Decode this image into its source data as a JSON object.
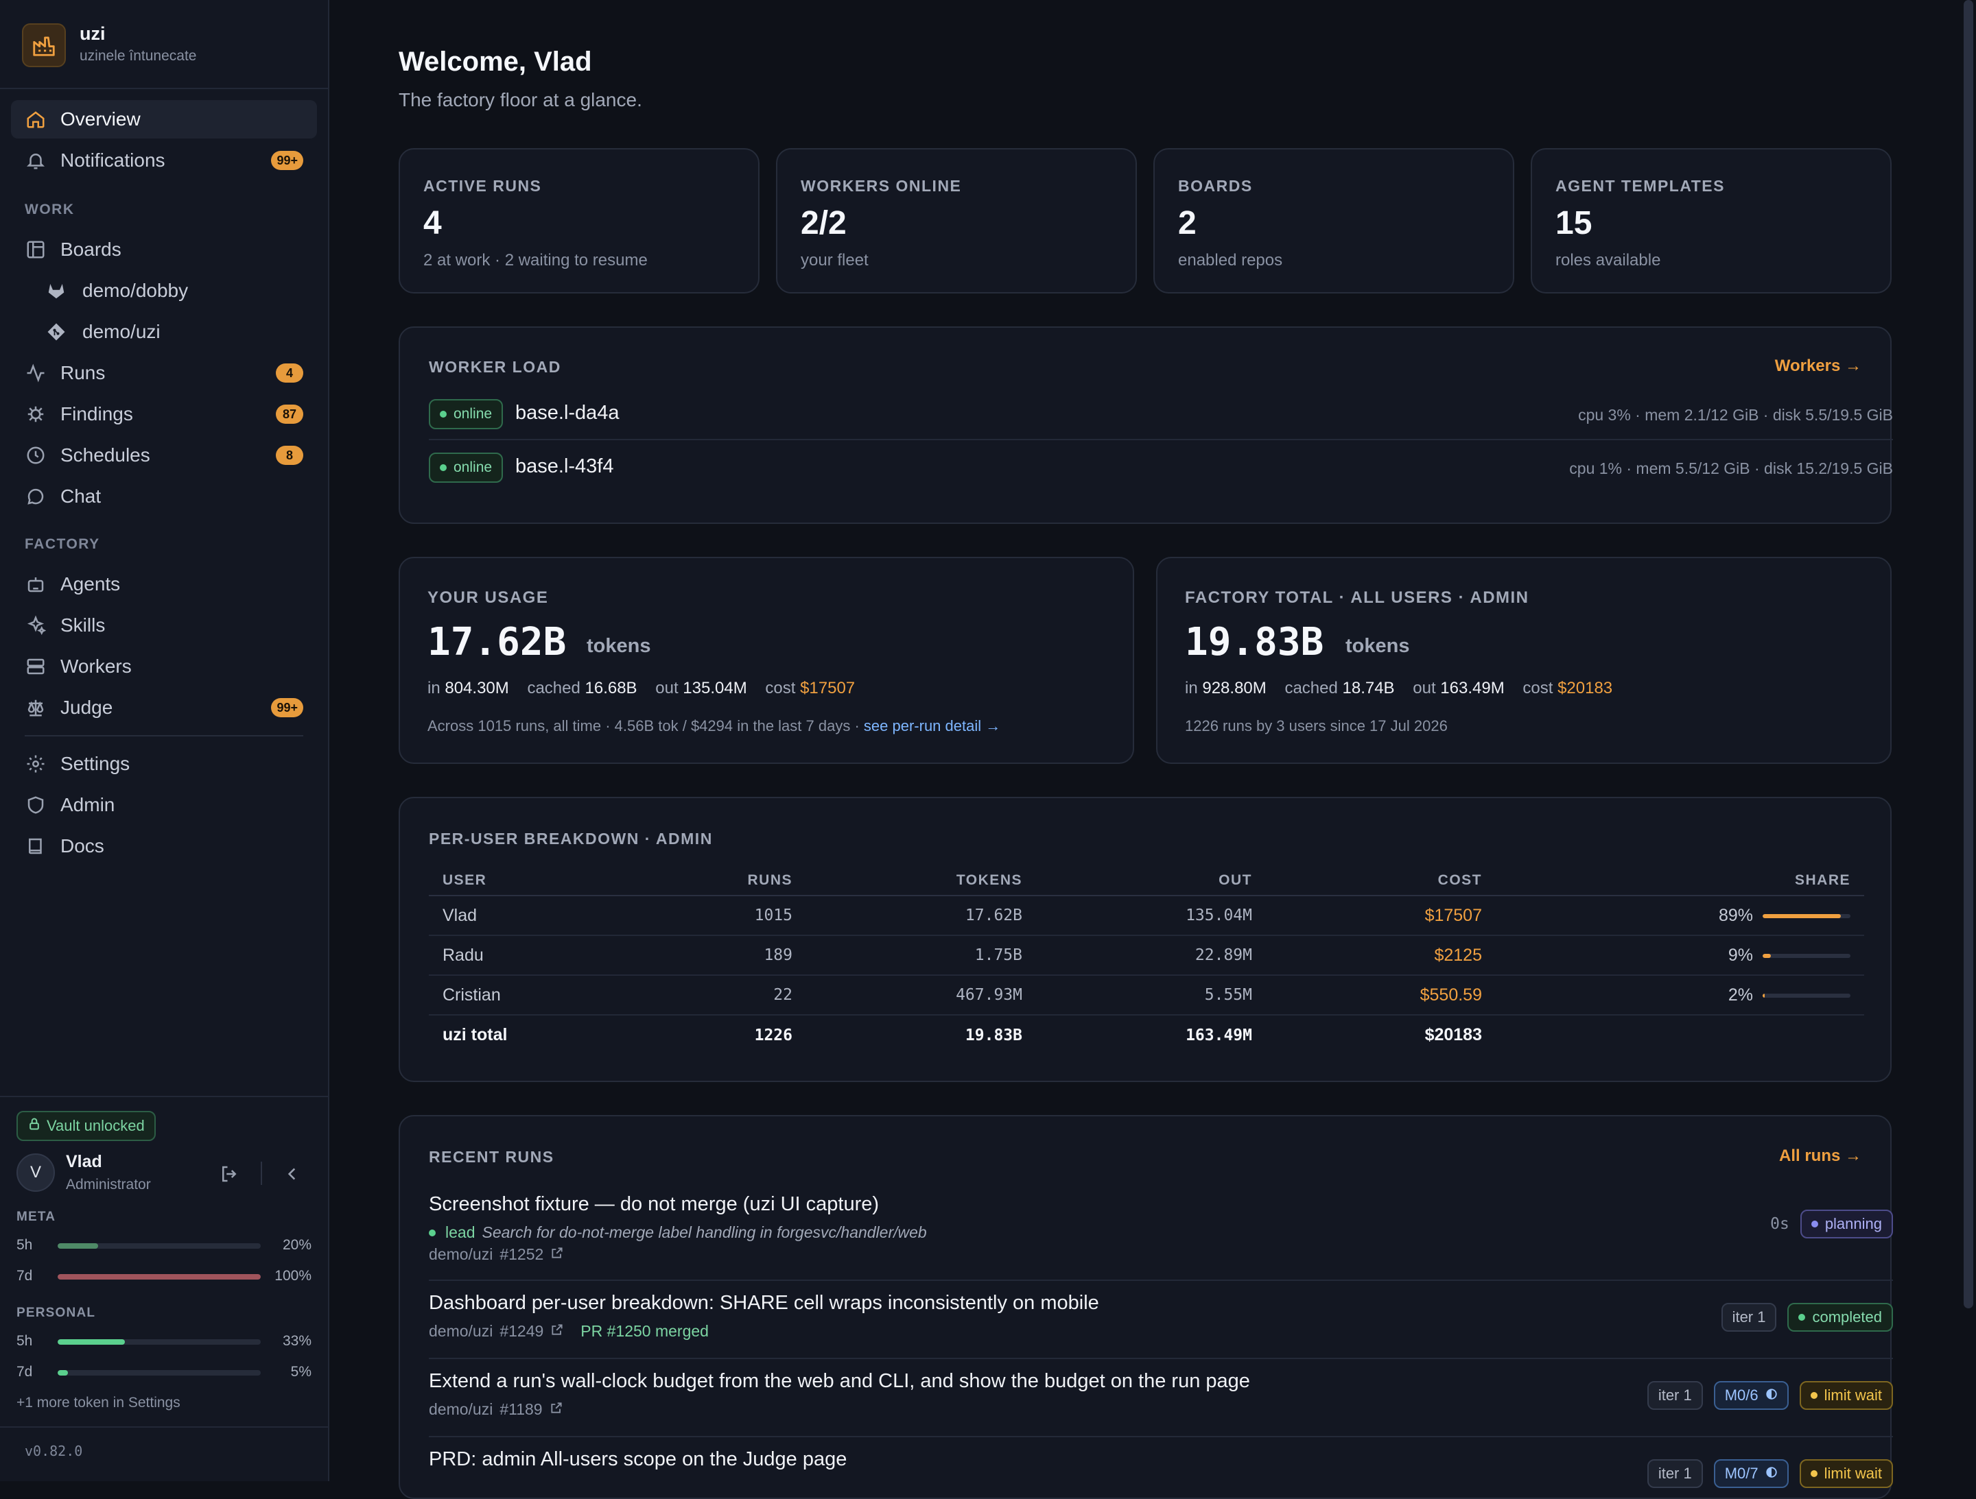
{
  "brand": {
    "name": "uzi",
    "subtitle": "uzinele întunecate"
  },
  "nav": {
    "overview": "Overview",
    "notifications": {
      "label": "Notifications",
      "badge": "99+"
    },
    "work_section": "WORK",
    "boards": "Boards",
    "repos": [
      {
        "label": "demo/dobby",
        "icon": "gitlab-icon"
      },
      {
        "label": "demo/uzi",
        "icon": "git-icon"
      }
    ],
    "runs": {
      "label": "Runs",
      "badge": "4"
    },
    "findings": {
      "label": "Findings",
      "badge": "87"
    },
    "schedules": {
      "label": "Schedules",
      "badge": "8"
    },
    "chat": "Chat",
    "factory_section": "FACTORY",
    "agents": "Agents",
    "skills": "Skills",
    "workers": "Workers",
    "judge": {
      "label": "Judge",
      "badge": "99+"
    },
    "settings": "Settings",
    "admin": "Admin",
    "docs": "Docs"
  },
  "sidebar_footer": {
    "vault": "Vault unlocked",
    "avatar_letter": "V",
    "user_name": "Vlad",
    "user_role": "Administrator",
    "meta_label": "META",
    "meta": [
      {
        "name": "5h",
        "pct": "20%",
        "value": 0.2,
        "color": "#4f8a67"
      },
      {
        "name": "7d",
        "pct": "100%",
        "value": 1.0,
        "color": "#a0545c"
      }
    ],
    "personal_label": "PERSONAL",
    "personal": [
      {
        "name": "5h",
        "pct": "33%",
        "value": 0.33,
        "color": "#5bd08e"
      },
      {
        "name": "7d",
        "pct": "5%",
        "value": 0.05,
        "color": "#5bd08e"
      }
    ],
    "more": "+1 more token in Settings",
    "version": "v0.82.0"
  },
  "header": {
    "title": "Welcome, Vlad",
    "subtitle": "The factory floor at a glance."
  },
  "stats": [
    {
      "label": "ACTIVE RUNS",
      "value": "4",
      "note": "2 at work · 2 waiting to resume"
    },
    {
      "label": "WORKERS ONLINE",
      "value": "2/2",
      "note": "your fleet"
    },
    {
      "label": "BOARDS",
      "value": "2",
      "note": "enabled repos"
    },
    {
      "label": "AGENT TEMPLATES",
      "value": "15",
      "note": "roles available"
    }
  ],
  "worker_load": {
    "title": "WORKER LOAD",
    "link": "Workers →",
    "workers": [
      {
        "status": "online",
        "name": "base.l-da4a",
        "stats": "cpu 3% · mem 2.1/12 GiB · disk 5.5/19.5 GiB"
      },
      {
        "status": "online",
        "name": "base.l-43f4",
        "stats": "cpu 1% · mem 5.5/12 GiB · disk 15.2/19.5 GiB"
      }
    ]
  },
  "your_usage": {
    "label": "YOUR USAGE",
    "value": "17.62B",
    "unit": "tokens",
    "in_label": "in",
    "in": "804.30M",
    "cached_label": "cached",
    "cached": "16.68B",
    "out_label": "out",
    "out": "135.04M",
    "cost_label": "cost",
    "cost": "$17507",
    "note": "Across 1015 runs, all time · 4.56B tok / $4294 in the last 7 days ·",
    "note_link": "see per-run detail →"
  },
  "factory_total": {
    "label": "FACTORY TOTAL · ALL USERS · ADMIN",
    "value": "19.83B",
    "unit": "tokens",
    "in_label": "in",
    "in": "928.80M",
    "cached_label": "cached",
    "cached": "18.74B",
    "out_label": "out",
    "out": "163.49M",
    "cost_label": "cost",
    "cost": "$20183",
    "note": "1226 runs by 3 users since 17 Jul 2026"
  },
  "breakdown": {
    "title": "PER-USER BREAKDOWN · ADMIN",
    "columns": [
      "USER",
      "RUNS",
      "TOKENS",
      "OUT",
      "COST",
      "SHARE"
    ],
    "rows": [
      {
        "user": "Vlad",
        "runs": "1015",
        "tokens": "17.62B",
        "out": "135.04M",
        "cost": "$17507",
        "share": "89%",
        "share_value": 0.89
      },
      {
        "user": "Radu",
        "runs": "189",
        "tokens": "1.75B",
        "out": "22.89M",
        "cost": "$2125",
        "share": "9%",
        "share_value": 0.09
      },
      {
        "user": "Cristian",
        "runs": "22",
        "tokens": "467.93M",
        "out": "5.55M",
        "cost": "$550.59",
        "share": "2%",
        "share_value": 0.02
      }
    ],
    "total": {
      "user": "uzi total",
      "runs": "1226",
      "tokens": "19.83B",
      "out": "163.49M",
      "cost": "$20183"
    }
  },
  "recent_runs": {
    "title": "RECENT RUNS",
    "link": "All runs →",
    "runs": [
      {
        "title": "Screenshot fixture — do not merge (uzi UI capture)",
        "lead": "lead",
        "desc": "Search for do-not-merge label handling in forgesvc/handler/web",
        "repo": "demo/uzi",
        "issue": "#1252",
        "elapsed": "0s",
        "status": "planning"
      },
      {
        "title": "Dashboard per-user breakdown: SHARE cell wraps inconsistently on mobile",
        "repo": "demo/uzi",
        "issue": "#1249",
        "pr": "PR #1250 merged",
        "iter": "iter 1",
        "status": "completed"
      },
      {
        "title": "Extend a run's wall-clock budget from the web and CLI, and show the budget on the run page",
        "repo": "demo/uzi",
        "issue": "#1189",
        "iter": "iter 1",
        "milestone": "M0/6",
        "status": "limit wait"
      },
      {
        "title": "PRD: admin All-users scope on the Judge page",
        "iter": "iter 1",
        "milestone": "M0/7",
        "status": "limit wait"
      }
    ]
  },
  "colors": {
    "accent": "#f0a040",
    "online": "#5bd08e",
    "planning": "#8a8df0",
    "limit": "#f3c54c"
  }
}
